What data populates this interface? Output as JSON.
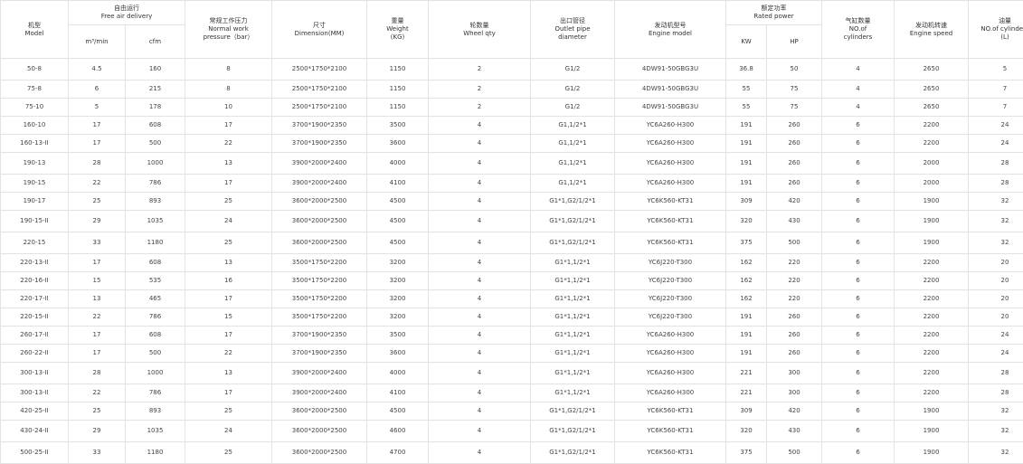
{
  "headers": {
    "model": [
      "机型",
      "Model"
    ],
    "free_air_delivery": [
      "自由运行",
      "Free air delivery"
    ],
    "fad_m3": "m³/min",
    "fad_cfm": "cfm",
    "pressure": [
      "常规工作压力",
      "Normal work",
      "pressure（bar）"
    ],
    "dimension": [
      "尺寸",
      "Dimension(MM)"
    ],
    "weight": [
      "重量",
      "Weight",
      "(KG)"
    ],
    "wheel": [
      "轮数量",
      "Wheel qty"
    ],
    "outlet": [
      "出口管径",
      "Outlet pipe",
      "diameter"
    ],
    "engine_model": [
      "发动机型号",
      "Engine model"
    ],
    "rated_power": [
      "额定功率",
      "Rated power"
    ],
    "kw": "KW",
    "hp": "HP",
    "cylinders": [
      "气缸数量",
      "NO.of",
      "cylinders"
    ],
    "engine_speed": [
      "发动机转速",
      "Engine speed"
    ],
    "oil": [
      "油量",
      "NO.of cylinders",
      "(L)"
    ]
  },
  "rows": [
    [
      "50-8",
      "4.5",
      "160",
      "8",
      "2500*1750*2100",
      "1150",
      "2",
      "G1/2",
      "4DW91-50GBG3U",
      "36.8",
      "50",
      "4",
      "2650",
      "5"
    ],
    [
      "75-8",
      "6",
      "215",
      "8",
      "2500*1750*2100",
      "1150",
      "2",
      "G1/2",
      "4DW91-50GBG3U",
      "55",
      "75",
      "4",
      "2650",
      "7"
    ],
    [
      "75-10",
      "5",
      "178",
      "10",
      "2500*1750*2100",
      "1150",
      "2",
      "G1/2",
      "4DW91-50GBG3U",
      "55",
      "75",
      "4",
      "2650",
      "7"
    ],
    [
      "160-10",
      "17",
      "608",
      "17",
      "3700*1900*2350",
      "3500",
      "4",
      "G1,1/2*1",
      "YC6A260-H300",
      "191",
      "260",
      "6",
      "2200",
      "24"
    ],
    [
      "160-13-II",
      "17",
      "500",
      "22",
      "3700*1900*2350",
      "3600",
      "4",
      "G1,1/2*1",
      "YC6A260-H300",
      "191",
      "260",
      "6",
      "2200",
      "24"
    ],
    [
      "190-13",
      "28",
      "1000",
      "13",
      "3900*2000*2400",
      "4000",
      "4",
      "G1,1/2*1",
      "YC6A260-H300",
      "191",
      "260",
      "6",
      "2000",
      "28"
    ],
    [
      "190-15",
      "22",
      "786",
      "17",
      "3900*2000*2400",
      "4100",
      "4",
      "G1,1/2*1",
      "YC6A260-H300",
      "191",
      "260",
      "6",
      "2000",
      "28"
    ],
    [
      "190-17",
      "25",
      "893",
      "25",
      "3600*2000*2500",
      "4500",
      "4",
      "G1*1,G2/1/2*1",
      "YC6K560-KT31",
      "309",
      "420",
      "6",
      "1900",
      "32"
    ],
    [
      "190-15-II",
      "29",
      "1035",
      "24",
      "3600*2000*2500",
      "4500",
      "4",
      "G1*1,G2/1/2*1",
      "YC6K560-KT31",
      "320",
      "430",
      "6",
      "1900",
      "32"
    ],
    [
      "220-15",
      "33",
      "1180",
      "25",
      "3600*2000*2500",
      "4500",
      "4",
      "G1*1,G2/1/2*1",
      "YC6K560-KT31",
      "375",
      "500",
      "6",
      "1900",
      "32"
    ],
    [
      "220-13-II",
      "17",
      "608",
      "13",
      "3500*1750*2200",
      "3200",
      "4",
      "G1*1,1/2*1",
      "YC6J220-T300",
      "162",
      "220",
      "6",
      "2200",
      "20"
    ],
    [
      "220-16-II",
      "15",
      "535",
      "16",
      "3500*1750*2200",
      "3200",
      "4",
      "G1*1,1/2*1",
      "YC6J220-T300",
      "162",
      "220",
      "6",
      "2200",
      "20"
    ],
    [
      "220-17-II",
      "13",
      "465",
      "17",
      "3500*1750*2200",
      "3200",
      "4",
      "G1*1,1/2*1",
      "YC6J220-T300",
      "162",
      "220",
      "6",
      "2200",
      "20"
    ],
    [
      "220-15-II",
      "22",
      "786",
      "15",
      "3500*1750*2200",
      "3200",
      "4",
      "G1*1,1/2*1",
      "YC6J220-T300",
      "191",
      "260",
      "6",
      "2200",
      "20"
    ],
    [
      "260-17-II",
      "17",
      "608",
      "17",
      "3700*1900*2350",
      "3500",
      "4",
      "G1*1,1/2*1",
      "YC6A260-H300",
      "191",
      "260",
      "6",
      "2200",
      "24"
    ],
    [
      "260-22-II",
      "17",
      "500",
      "22",
      "3700*1900*2350",
      "3600",
      "4",
      "G1*1,1/2*1",
      "YC6A260-H300",
      "191",
      "260",
      "6",
      "2200",
      "24"
    ],
    [
      "300-13-II",
      "28",
      "1000",
      "13",
      "3900*2000*2400",
      "4000",
      "4",
      "G1*1,1/2*1",
      "YC6A260-H300",
      "221",
      "300",
      "6",
      "2200",
      "28"
    ],
    [
      "300-13-II",
      "22",
      "786",
      "17",
      "3900*2000*2400",
      "4100",
      "4",
      "G1*1,1/2*1",
      "YC6A260-H300",
      "221",
      "300",
      "6",
      "2200",
      "28"
    ],
    [
      "420-25-II",
      "25",
      "893",
      "25",
      "3600*2000*2500",
      "4500",
      "4",
      "G1*1,G2/1/2*1",
      "YC6K560-KT31",
      "309",
      "420",
      "6",
      "1900",
      "32"
    ],
    [
      "430-24-II",
      "29",
      "1035",
      "24",
      "3600*2000*2500",
      "4600",
      "4",
      "G1*1,G2/1/2*1",
      "YC6K560-KT31",
      "320",
      "430",
      "6",
      "1900",
      "32"
    ],
    [
      "500-25-II",
      "33",
      "1180",
      "25",
      "3600*2000*2500",
      "4700",
      "4",
      "G1*1,G2/1/2*1",
      "YC6K560-KT31",
      "375",
      "500",
      "6",
      "1900",
      "32"
    ]
  ]
}
